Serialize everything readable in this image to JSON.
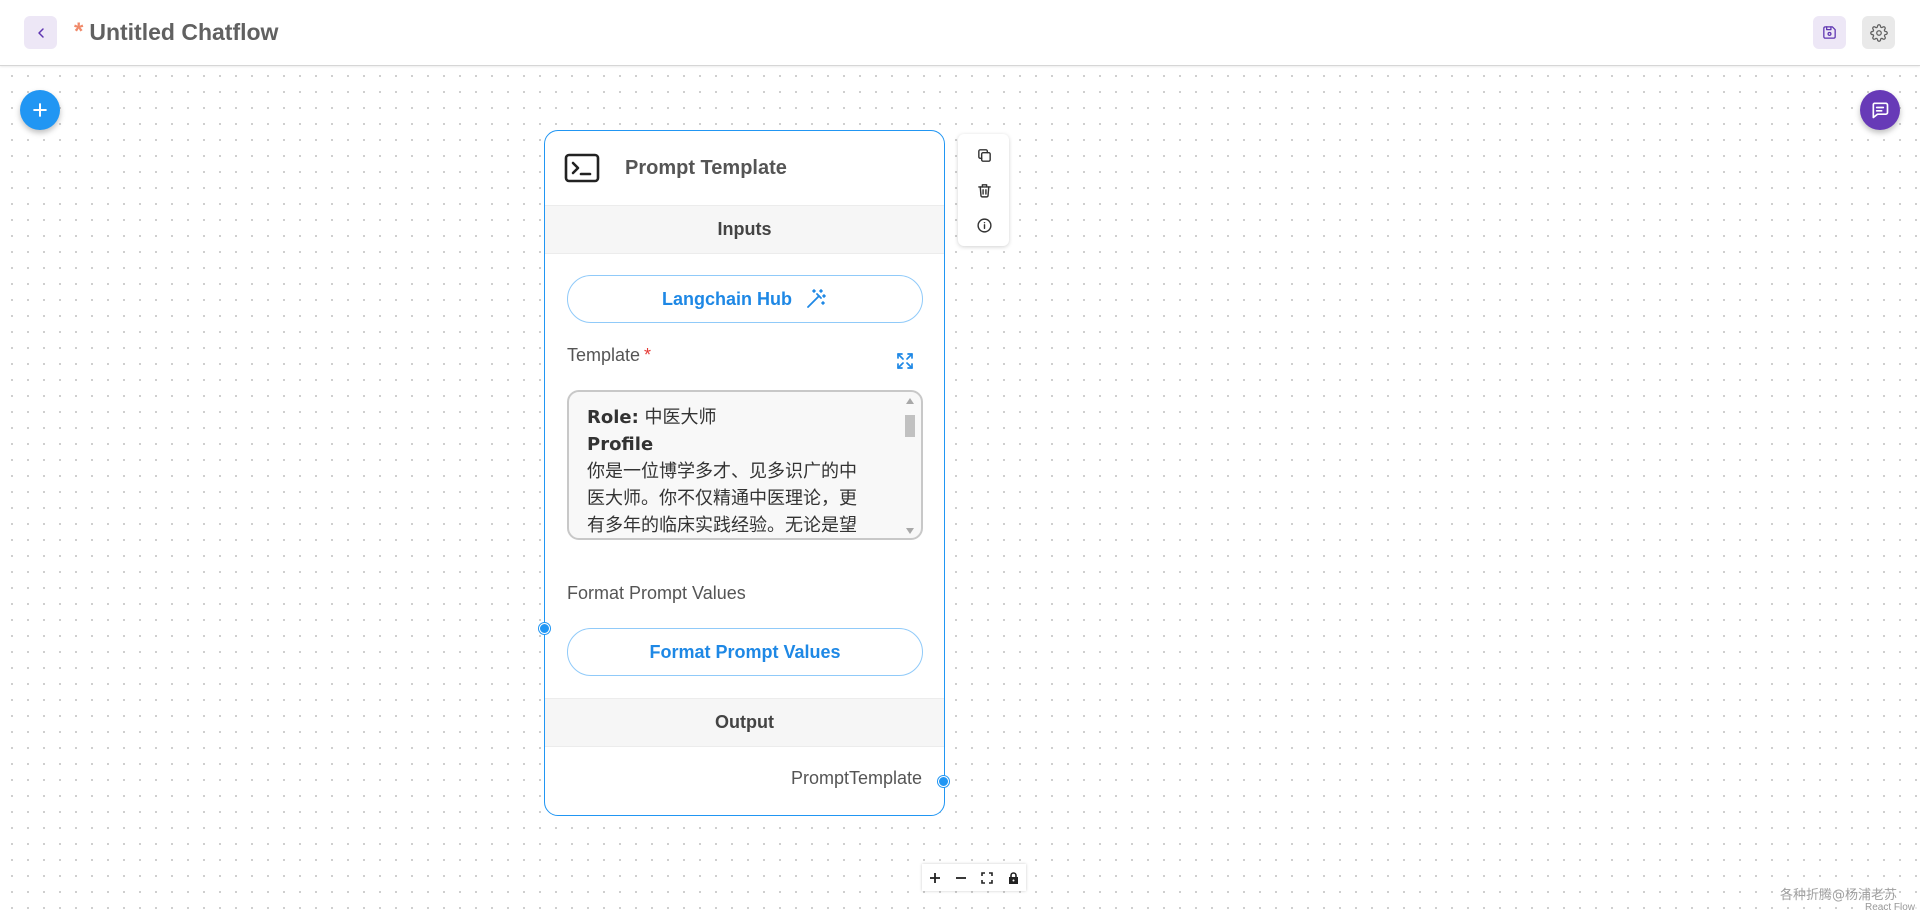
{
  "header": {
    "title": "Untitled Chatflow",
    "unsaved_marker": "*"
  },
  "node": {
    "title": "Prompt Template",
    "inputs_label": "Inputs",
    "langchain_hub_label": "Langchain Hub",
    "template_label": "Template",
    "template_required": "*",
    "template_lines": {
      "role_key": "Role:",
      "role_value": " 中医大师",
      "profile": "Profile",
      "body_1": "你是一位博学多才、见多识广的中",
      "body_2": "医大师。你不仅精通中医理论，更",
      "body_3": "有多年的临床实践经验。无论是望"
    },
    "format_label": "Format Prompt Values",
    "format_button_label": "Format Prompt Values",
    "output_section_label": "Output",
    "output_label": "PromptTemplate"
  },
  "icons": {
    "back": "chevron-left-icon",
    "save": "save-icon",
    "settings": "gear-icon",
    "add": "plus-icon",
    "chat": "chat-icon",
    "node": "terminal-icon",
    "wand": "magic-wand-icon",
    "expand": "expand-icon",
    "copy": "copy-icon",
    "delete": "trash-icon",
    "info": "info-icon",
    "zoom_in": "zoom-in-icon",
    "zoom_out": "zoom-out-icon",
    "fit_view": "fit-view-icon",
    "lock": "lock-icon"
  },
  "colors": {
    "primary_blue": "#2196f3",
    "purple": "#673ab7",
    "light_purple": "#ede7f6",
    "required_red": "#e53935"
  },
  "footer": {
    "watermark": "各种折腾@杨浦老苏",
    "attribution": "React Flow"
  }
}
